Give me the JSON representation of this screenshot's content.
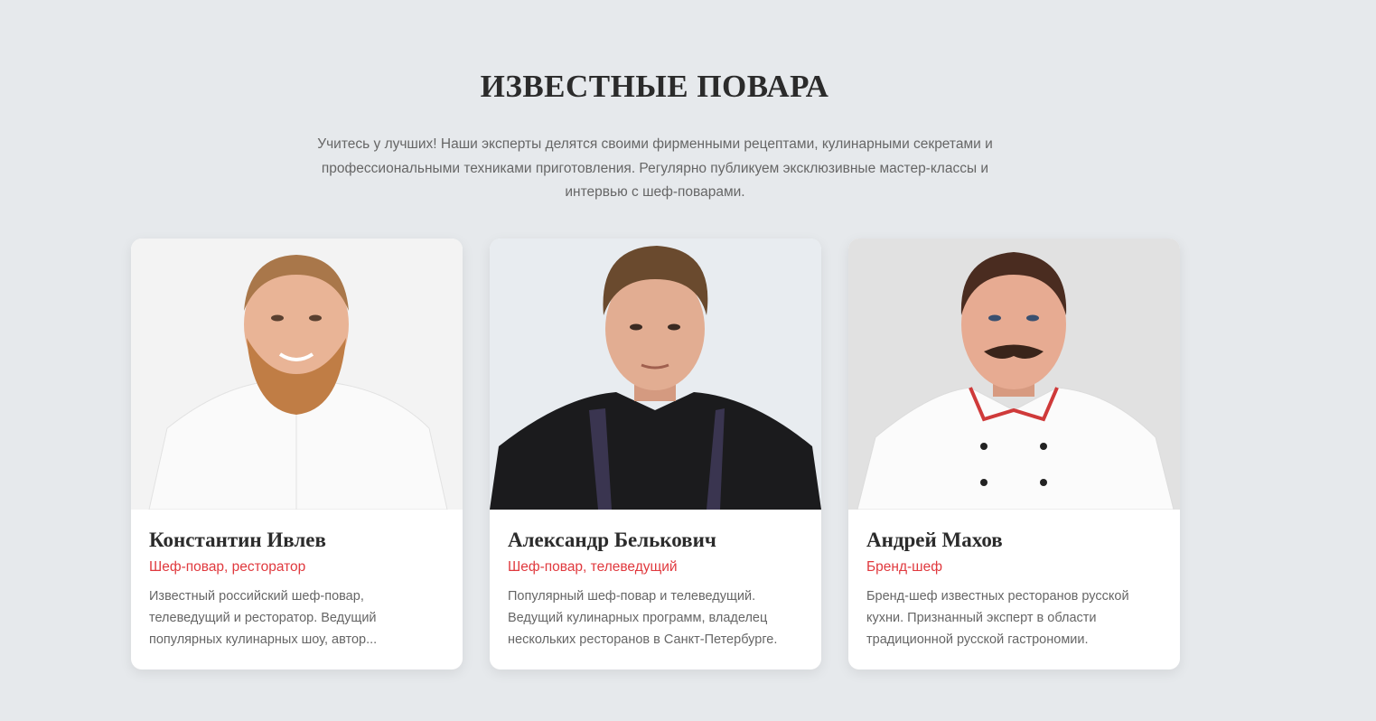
{
  "section": {
    "title": "ИЗВЕСТНЫЕ ПОВАРА",
    "intro": "Учитесь у лучших! Наши эксперты делятся своими фирменными рецептами, кулинарными секретами и профессиональными техниками приготовления. Регулярно публикуем эксклюзивные мастер-классы и интервью с шеф-поварами."
  },
  "colors": {
    "background": "#e6e9ec",
    "accent": "#e0393e",
    "card": "#ffffff"
  },
  "chefs": [
    {
      "name": "Константин Ивлев",
      "role": "Шеф-повар, ресторатор",
      "description": "Известный российский шеф-повар, телеведущий и ресторатор. Ведущий популярных кулинарных шоу, автор..."
    },
    {
      "name": "Александр Белькович",
      "role": "Шеф-повар, телеведущий",
      "description": "Популярный шеф-повар и телеведущий. Ведущий кулинарных программ, владелец нескольких ресторанов в Санкт-Петербурге."
    },
    {
      "name": "Андрей Махов",
      "role": "Бренд-шеф",
      "description": "Бренд-шеф известных ресторанов русской кухни. Признанный эксперт в области традиционной русской гастрономии."
    }
  ]
}
